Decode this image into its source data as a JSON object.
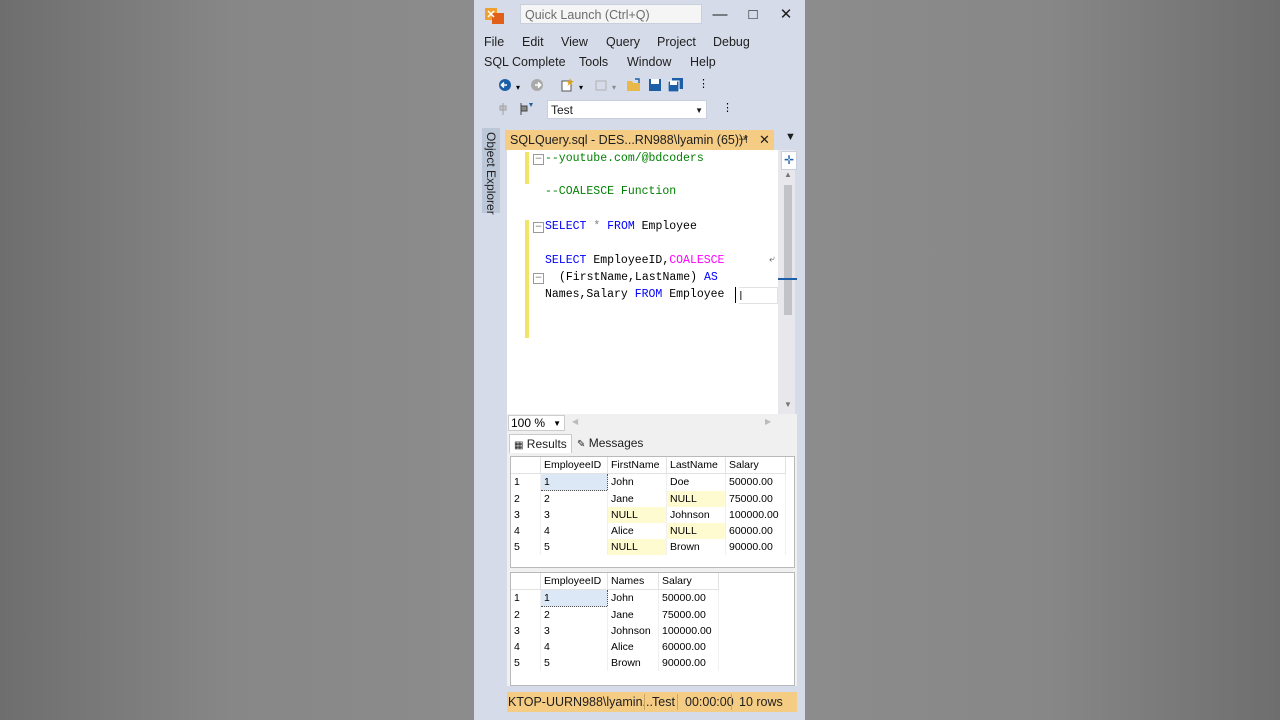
{
  "window": {
    "quick_launch_placeholder": "Quick Launch (Ctrl+Q)",
    "minimize": "—",
    "maximize": "□",
    "close": "✕"
  },
  "menu_row1": [
    "File",
    "Edit",
    "View",
    "Query",
    "Project",
    "Debug"
  ],
  "menu_row2": [
    "SQL Complete",
    "Tools",
    "Window",
    "Help"
  ],
  "toolbar": {
    "database": "Test"
  },
  "side_panel": {
    "object_explorer": "Object Explorer"
  },
  "doc_tab": {
    "title": "SQLQuery.sql - DES...RN988\\lyamin (65))*",
    "pin": "⊣",
    "close": "✕"
  },
  "editor": {
    "line1": "--youtube.com/@bdcoders",
    "line2": "--COALESCE Function",
    "line3_kw1": "SELECT",
    "line3_star": " * ",
    "line3_kw2": "FROM",
    "line3_rest": " Employee",
    "line4_kw": "SELECT",
    "line4_mid": " EmployeeID,",
    "line4_fn": "COALESCE",
    "line5_a": "(FirstName,LastName) ",
    "line5_kw": "AS",
    "line6_a": "Names,Salary ",
    "line6_kw": "FROM",
    "line6_b": " Employee"
  },
  "zoom": "100 %",
  "results_tabs": {
    "results": "Results",
    "messages": "Messages"
  },
  "grid1": {
    "columns": [
      "EmployeeID",
      "FirstName",
      "LastName",
      "Salary"
    ],
    "rows": [
      [
        "1",
        "1",
        "John",
        "Doe",
        "50000.00"
      ],
      [
        "2",
        "2",
        "Jane",
        "NULL",
        "75000.00"
      ],
      [
        "3",
        "3",
        "NULL",
        "Johnson",
        "100000.00"
      ],
      [
        "4",
        "4",
        "Alice",
        "NULL",
        "60000.00"
      ],
      [
        "5",
        "5",
        "NULL",
        "Brown",
        "90000.00"
      ]
    ]
  },
  "grid2": {
    "columns": [
      "EmployeeID",
      "Names",
      "Salary"
    ],
    "rows": [
      [
        "1",
        "1",
        "John",
        "50000.00"
      ],
      [
        "2",
        "2",
        "Jane",
        "75000.00"
      ],
      [
        "3",
        "3",
        "Johnson",
        "100000.00"
      ],
      [
        "4",
        "4",
        "Alice",
        "60000.00"
      ],
      [
        "5",
        "5",
        "Brown",
        "90000.00"
      ]
    ]
  },
  "status": {
    "server": "KTOP-UURN988\\lyamin...",
    "database": "Test",
    "time": "00:00:00",
    "rows": "10 rows"
  },
  "colors": {
    "accent": "#f5cc84",
    "chrome": "#d6dbe9",
    "comment": "#008000",
    "keyword": "#0000ff",
    "function": "#ff00ff"
  }
}
